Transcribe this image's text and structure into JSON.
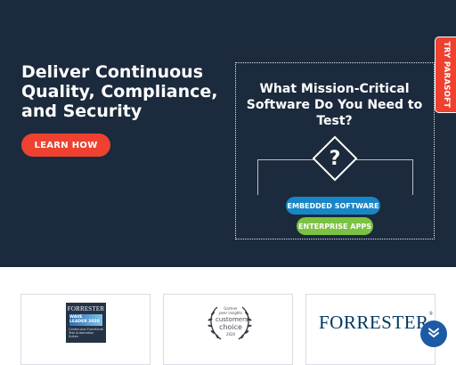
{
  "hero": {
    "headline": [
      "Deliver Continuous",
      "Quality, Compliance,",
      "and Security"
    ],
    "cta_label": "LEARN HOW",
    "background_color": "#1b2a3c",
    "accent_color": "#ef4130"
  },
  "mission": {
    "title": [
      "What Mission-Critical",
      "Software Do You Need to",
      "Test?"
    ],
    "icon_glyph": "?",
    "options": [
      {
        "label": "EMBEDDED SOFTWARE",
        "color": "#1886c6"
      },
      {
        "label": "ENTERPRISE APPS",
        "color": "#7cc242"
      }
    ]
  },
  "side_tab": {
    "label": "TRY PARASOFT",
    "color": "#ef4130"
  },
  "awards": [
    {
      "name": "forrester-wave-badge",
      "brand": "FORRESTER",
      "lines": [
        "WAVE",
        "LEADER 2020"
      ],
      "subtitle": [
        "Continuous Functional",
        "Test Automation Suites"
      ]
    },
    {
      "name": "gartner-peer-insights-badge",
      "lines": [
        "Gartner",
        "peer insights",
        "customers'",
        "choice",
        "2020"
      ]
    },
    {
      "name": "forrester-logo",
      "brand": "FORRESTER",
      "mark": "®",
      "color": "#00365e"
    }
  ],
  "scroll_button": {
    "icon": "double-chevron-up-icon",
    "color": "#1d5aa6"
  }
}
